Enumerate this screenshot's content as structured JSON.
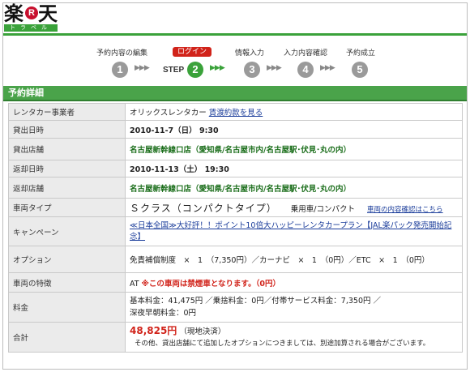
{
  "logo": {
    "kanji_left": "楽",
    "r": "R",
    "kanji_right": "天",
    "subtitle": "トラベル"
  },
  "steps": [
    {
      "label": "予約内容の編集",
      "num": "1"
    },
    {
      "label": "ログイン",
      "num": "2",
      "prefix": "STEP"
    },
    {
      "label": "情報入力",
      "num": "3"
    },
    {
      "label": "入力内容確認",
      "num": "4"
    },
    {
      "label": "予約成立",
      "num": "5"
    }
  ],
  "arrow_glyphs": "▶▶▶",
  "section_title": "予約詳細",
  "rows": {
    "company": {
      "label": "レンタカー事業者",
      "value": "オリックスレンタカー",
      "link": "賃渡約款を見る"
    },
    "pickup_date": {
      "label": "貸出日時",
      "value": "2010-11-7（日） 9:30"
    },
    "pickup_store": {
      "label": "貸出店舗",
      "value": "名古屋新幹線口店（愛知県/名古屋市内/名古屋駅･伏見･丸の内）"
    },
    "return_date": {
      "label": "返却日時",
      "value": "2010-11-13（土） 19:30"
    },
    "return_store": {
      "label": "返却店舗",
      "value": "名古屋新幹線口店（愛知県/名古屋市内/名古屋駅･伏見･丸の内）"
    },
    "car_type": {
      "label": "車両タイプ",
      "value": "Ｓクラス（コンパクトタイプ）",
      "sub": "乗用車/コンパクト",
      "link": "車両の内容確認はこちら"
    },
    "campaign": {
      "label": "キャンペーン",
      "value": "≪日本全国≫大好評！！ポイント10倍大ハッピーレンタカープラン【JAL楽パック発売開始記念】"
    },
    "options": {
      "label": "オプション",
      "items": [
        "免責補償制度　×　1　（7,350円）／カーナビ　×　1　（0円）／ETC　×　1　（0円）"
      ]
    },
    "features": {
      "label": "車両の特徴",
      "prefix": "AT",
      "value": "※この車両は禁煙車となります。（0円）"
    },
    "fees": {
      "label": "料金",
      "line1": "基本料金：41,475円 ／乗捨料金：0円／付帯サービス料金：7,350円 ／",
      "line2": "深夜早朝料金：0円"
    },
    "total": {
      "label": "合計",
      "amount": "48,825円",
      "note": "（現地決済）",
      "footnote": "その他、貸出店舗にて追加したオプションにつきましては、別途加算される場合がございます。"
    }
  },
  "colors": {
    "accent_green": "#3aa23a",
    "active_red": "#d1231a",
    "store_green": "#1b6e1b",
    "link_blue": "#1a3c9a"
  }
}
